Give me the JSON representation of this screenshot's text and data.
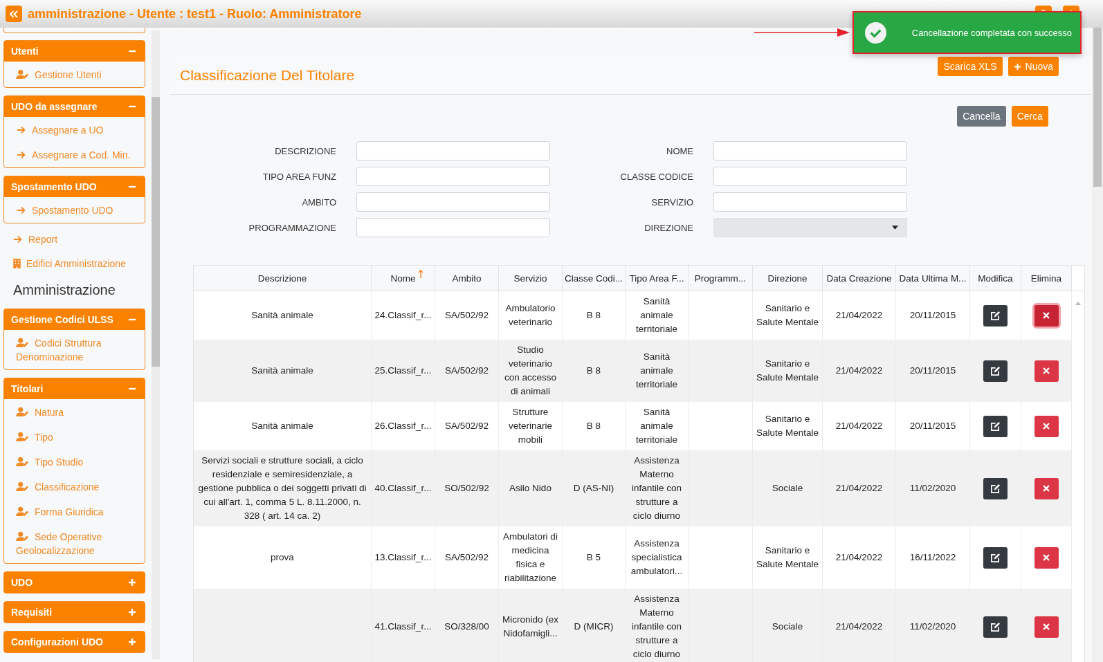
{
  "header": {
    "title": "amministrazione - Utente : test1 - Ruolo: Amministratore"
  },
  "sidebar": {
    "sections": [
      {
        "kind": "group",
        "title": "Utenti",
        "expanded": true,
        "items": [
          {
            "label": "Gestione Utenti",
            "kind": "person"
          }
        ]
      },
      {
        "kind": "group",
        "title": "UDO da assegnare",
        "expanded": true,
        "items": [
          {
            "label": "Assegnare a UO",
            "kind": "arrow"
          },
          {
            "label": "Assegnare a Cod. Min.",
            "kind": "arrow"
          }
        ]
      },
      {
        "kind": "group",
        "title": "Spostamento UDO",
        "expanded": true,
        "items": [
          {
            "label": "Spostamento UDO",
            "kind": "arrow"
          }
        ]
      },
      {
        "kind": "arrow_link",
        "label": "Report"
      },
      {
        "kind": "building_link",
        "label": "Edifici Amministrazione"
      },
      {
        "kind": "heading",
        "label": "Amministrazione"
      },
      {
        "kind": "group",
        "title": "Gestione Codici ULSS",
        "expanded": true,
        "items": [
          {
            "label": "Codici Struttura Denominazione",
            "kind": "person"
          }
        ]
      },
      {
        "kind": "group",
        "title": "Titolari",
        "expanded": true,
        "items": [
          {
            "label": "Natura",
            "kind": "person"
          },
          {
            "label": "Tipo",
            "kind": "person"
          },
          {
            "label": "Tipo Studio",
            "kind": "person"
          },
          {
            "label": "Classificazione",
            "kind": "person"
          },
          {
            "label": "Forma Giuridica",
            "kind": "person"
          },
          {
            "label": "Sede Operative Geolocalizzazione",
            "kind": "person"
          }
        ]
      },
      {
        "kind": "group",
        "title": "UDO",
        "expanded": false
      },
      {
        "kind": "group",
        "title": "Requisiti",
        "expanded": false
      },
      {
        "kind": "group",
        "title": "Configurazioni UDO",
        "expanded": false
      }
    ]
  },
  "toast": {
    "message": "Cancellazione completata con successo"
  },
  "page": {
    "title": "Classificazione Del Titolare",
    "actions": [
      {
        "label": "Scarica XLS",
        "kind": "plain"
      },
      {
        "label": "Nuova",
        "kind": "add"
      }
    ]
  },
  "filters": {
    "buttons": [
      {
        "label": "Cancella",
        "kind": "secondary"
      },
      {
        "label": "Cerca",
        "kind": "primary"
      }
    ],
    "fields": [
      {
        "label": "DESCRIZIONE",
        "kind": "text"
      },
      {
        "label": "NOME",
        "kind": "text"
      },
      {
        "label": "TIPO AREA FUNZ",
        "kind": "text"
      },
      {
        "label": "CLASSE CODICE",
        "kind": "text"
      },
      {
        "label": "AMBITO",
        "kind": "text"
      },
      {
        "label": "SERVIZIO",
        "kind": "text"
      },
      {
        "label": "PROGRAMMAZIONE",
        "kind": "text"
      },
      {
        "label": "DIREZIONE",
        "kind": "select"
      }
    ]
  },
  "table": {
    "columns": [
      {
        "label": "Descrizione",
        "sorted": false
      },
      {
        "label": "Nome",
        "sorted": true
      },
      {
        "label": "Ambito",
        "sorted": false
      },
      {
        "label": "Servizio",
        "sorted": false
      },
      {
        "label": "Classe Codi...",
        "sorted": false
      },
      {
        "label": "Tipo Area F...",
        "sorted": false
      },
      {
        "label": "Programm...",
        "sorted": false
      },
      {
        "label": "Direzione",
        "sorted": false
      },
      {
        "label": "Data Creazione",
        "sorted": false
      },
      {
        "label": "Data Ultima M...",
        "sorted": false
      },
      {
        "label": "Modifica",
        "sorted": false
      },
      {
        "label": "Elimina",
        "sorted": false
      }
    ],
    "rows": [
      {
        "cells": [
          "Sanità animale",
          "24.Classif_r...",
          "SA/502/92",
          "Ambulatorio veterinario",
          "B 8",
          "Sanità animale territoriale",
          "",
          "Sanitario e Salute Mentale",
          "21/04/2022",
          "20/11/2015"
        ],
        "delete_focused": true
      },
      {
        "cells": [
          "Sanità animale",
          "25.Classif_r...",
          "SA/502/92",
          "Studio veterinario con accesso di animali",
          "B 8",
          "Sanità animale territoriale",
          "",
          "Sanitario e Salute Mentale",
          "21/04/2022",
          "20/11/2015"
        ],
        "delete_focused": false
      },
      {
        "cells": [
          "Sanità animale",
          "26.Classif_r...",
          "SA/502/92",
          "Strutture veterinarie mobili",
          "B 8",
          "Sanità animale territoriale",
          "",
          "Sanitario e Salute Mentale",
          "21/04/2022",
          "20/11/2015"
        ],
        "delete_focused": false
      },
      {
        "cells": [
          "Servizi sociali e strutture sociali, a ciclo residenziale e semiresidenziale, a gestione pubblica o dei soggetti privati di cui all'art. 1, comma 5 L. 8.11.2000, n. 328 ( art. 14 ca. 2)",
          "40.Classif_r...",
          "SO/502/92",
          "Asilo Nido",
          "D (AS-NI)",
          "Assistenza Materno infantile con strutture a ciclo diurno",
          "",
          "Sociale",
          "21/04/2022",
          "11/02/2020"
        ],
        "delete_focused": false
      },
      {
        "cells": [
          "prova",
          "13.Classif_r...",
          "SA/502/92",
          "Ambulatori di medicina fisica e riabilitazione",
          "B 5",
          "Assistenza specialistica ambulatori...",
          "",
          "Sanitario e Salute Mentale",
          "21/04/2022",
          "16/11/2022"
        ],
        "delete_focused": false
      },
      {
        "cells": [
          "",
          "41.Classif_r...",
          "SO/328/00",
          "Micronido (ex Nidofamigli...",
          "D (MICR)",
          "Assistenza Materno infantile con strutture a ciclo diurno",
          "",
          "Sociale",
          "21/04/2022",
          "11/02/2020"
        ],
        "delete_focused": false
      }
    ]
  }
}
